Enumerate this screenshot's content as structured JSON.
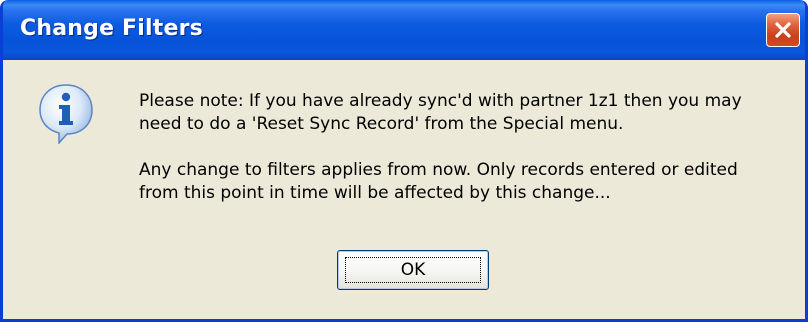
{
  "dialog": {
    "title": "Change Filters",
    "icon": "info-icon",
    "message_line1": "Please note: If you have already sync'd with partner 1z1 then you may need to do a 'Reset Sync Record' from the Special menu.",
    "message_line2": "Any change to filters applies from now.  Only records entered or edited from this point in time will be affected by this change...",
    "ok_label": "OK",
    "close_icon": "close-icon"
  },
  "colors": {
    "title_bar": "#0753d8",
    "dialog_background": "#ece9d8",
    "close_button": "#d04c22",
    "info_icon": "#2f7fe0"
  }
}
